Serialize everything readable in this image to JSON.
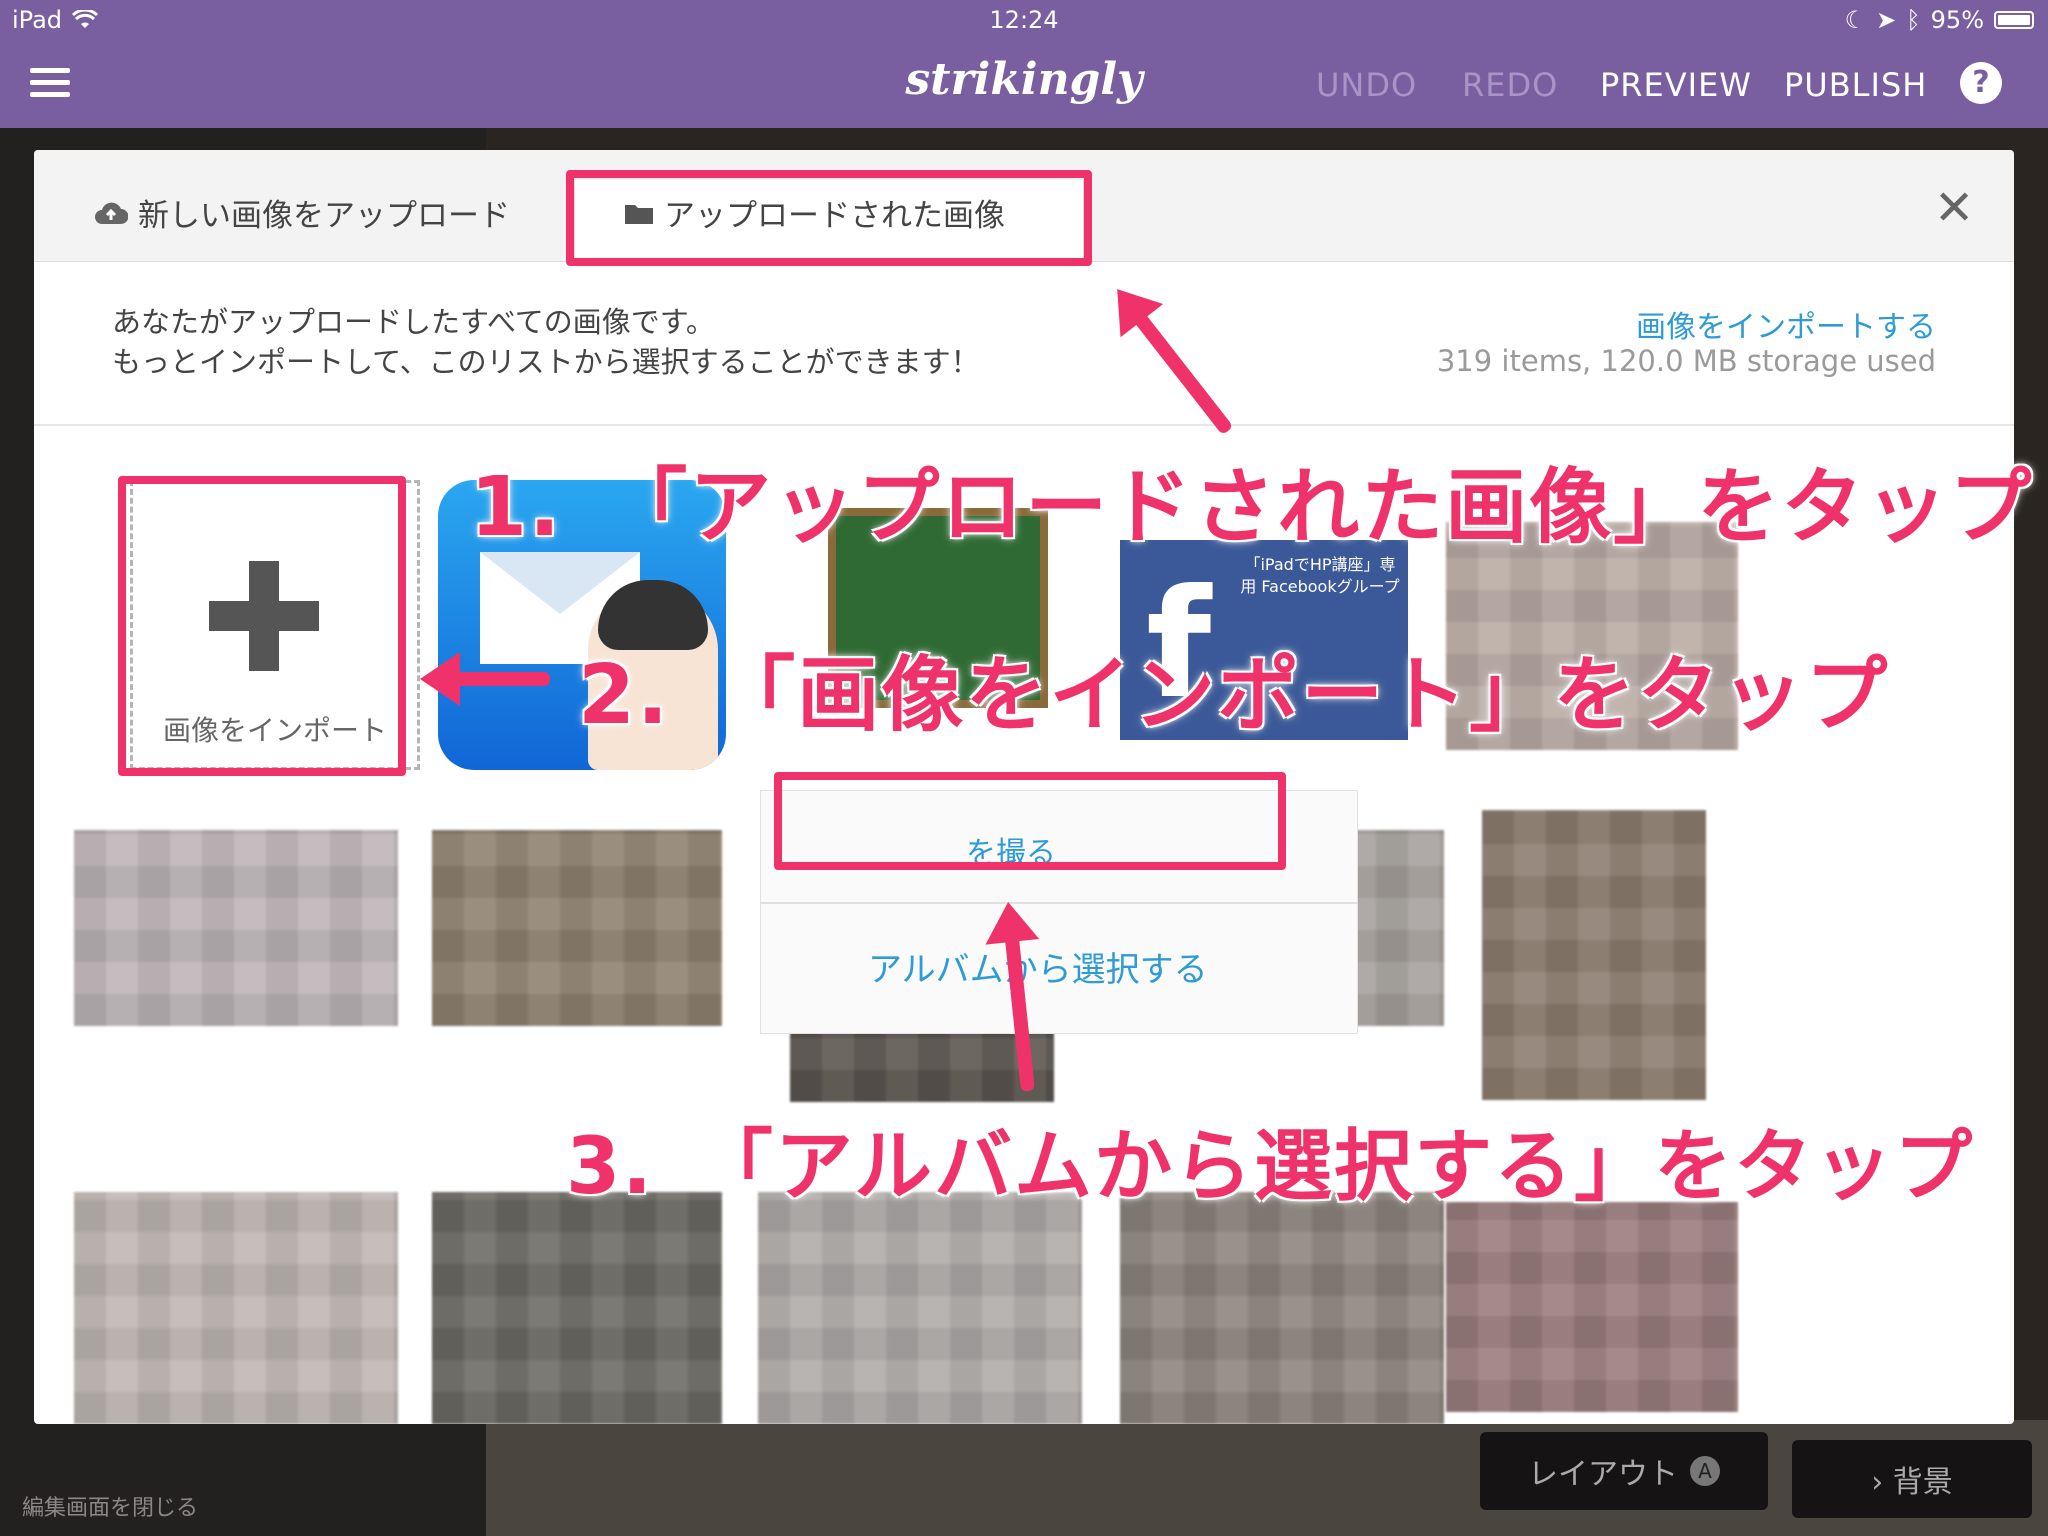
{
  "status_bar": {
    "device": "iPad",
    "time": "12:24",
    "battery": "95%"
  },
  "app_bar": {
    "brand": "strikingly",
    "undo": "UNDO",
    "redo": "REDO",
    "preview": "PREVIEW",
    "publish": "PUBLISH",
    "help": "?"
  },
  "editor": {
    "close_editor": "編集画面を閉じる",
    "layout_label": "レイアウト",
    "layout_badge": "A",
    "background_label": "› 背景"
  },
  "modal": {
    "tabs": [
      {
        "label": "新しい画像をアップロード",
        "icon": "cloud-upload-icon"
      },
      {
        "label": "アップロードされた画像",
        "icon": "folder-icon",
        "active": true
      }
    ],
    "info_line1": "あなたがアップロードしたすべての画像です。",
    "info_line2": "もっとインポートして、このリストから選択することができます！",
    "import_link": "画像をインポートする",
    "storage": "319 items, 120.0 MB storage used",
    "import_tile_label": "画像をインポート",
    "fb_tile_text": "「iPadでHP講座」専用 Facebookグループ"
  },
  "popover": {
    "take_photo_partial": "を撮る",
    "choose_album": "アルバムから選択する"
  },
  "annotations": {
    "step1": "1.　「アップロードされた画像」をタップ",
    "step2": "2.　「画像をインポート」をタップ",
    "step3": "3.　「アルバムから選択する」をタップ",
    "color": "#f0326b"
  }
}
